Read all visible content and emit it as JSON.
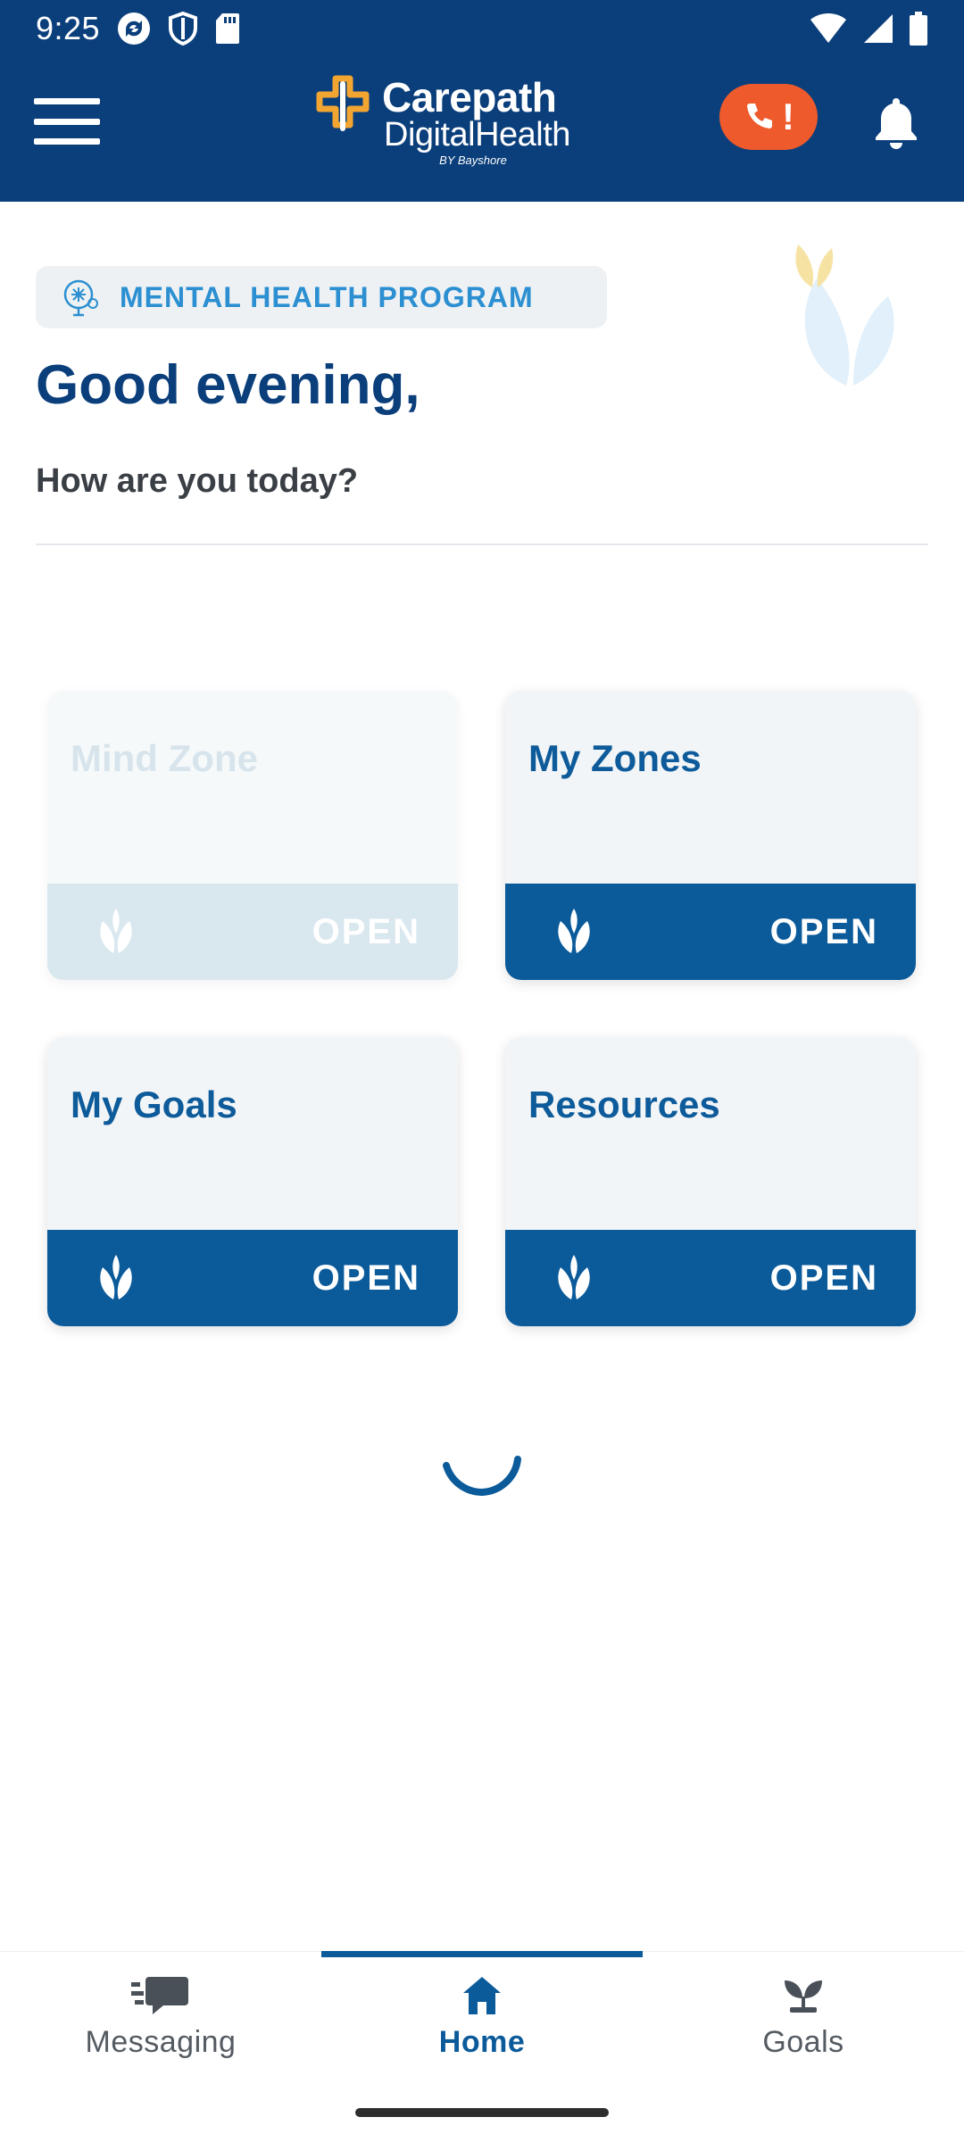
{
  "status_bar": {
    "time": "9:25",
    "left_icons": [
      "sync-icon",
      "shield-icon",
      "sd-card-icon"
    ],
    "right_icons": [
      "wifi-icon",
      "signal-icon",
      "battery-icon"
    ]
  },
  "header": {
    "logo_line1": "Carepath",
    "logo_line2": "DigitalHealth",
    "logo_line3": "BY Bayshore",
    "alert_symbol": "!",
    "colors": {
      "background": "#0b3f7b",
      "alert": "#ee5a2b"
    }
  },
  "program_badge": {
    "label": "MENTAL HEALTH PROGRAM",
    "icon": "brain-icon"
  },
  "greeting": {
    "title": "Good evening,",
    "subtitle": "How are you today?"
  },
  "cards": [
    {
      "title": "Mind Zone",
      "action": "OPEN",
      "disabled": true
    },
    {
      "title": "My Zones",
      "action": "OPEN",
      "disabled": false
    },
    {
      "title": "My Goals",
      "action": "OPEN",
      "disabled": false
    },
    {
      "title": "Resources",
      "action": "OPEN",
      "disabled": false
    }
  ],
  "bottom_nav": {
    "items": [
      {
        "label": "Messaging",
        "icon": "chat-icon",
        "active": false
      },
      {
        "label": "Home",
        "icon": "home-icon",
        "active": true
      },
      {
        "label": "Goals",
        "icon": "sprout-icon",
        "active": false
      }
    ]
  }
}
